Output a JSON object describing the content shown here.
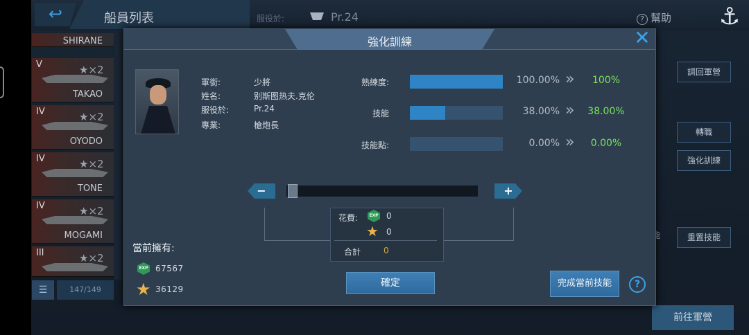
{
  "header": {
    "title": "船員列表",
    "service_label": "服役於:",
    "service_ship": "Pr.24",
    "help_label": "幫助"
  },
  "ship_list": [
    {
      "name": "SHIRANE",
      "tier": "",
      "mult": ""
    },
    {
      "name": "TAKAO",
      "tier": "V",
      "mult": "★×2"
    },
    {
      "name": "OYODO",
      "tier": "IV",
      "mult": "★×2"
    },
    {
      "name": "TONE",
      "tier": "IV",
      "mult": "★×2"
    },
    {
      "name": "MOGAMI",
      "tier": "IV",
      "mult": "★×2"
    },
    {
      "name": "",
      "tier": "III",
      "mult": "★×2"
    }
  ],
  "list_footer": {
    "count": "147/149"
  },
  "right_buttons": {
    "recall": "調回軍營",
    "transfer": "轉職",
    "train": "強化訓練",
    "skill_partial": "能",
    "reset_skill": "重置技能",
    "goto_barracks": "前往軍營"
  },
  "modal": {
    "title": "強化訓練",
    "info": {
      "rank_label": "軍銜:",
      "rank": "少將",
      "name_label": "姓名:",
      "name": "别斯图热夫.克伦",
      "service_label": "服役於:",
      "service": "Pr.24",
      "job_label": "專業:",
      "job": "槍炮長"
    },
    "stats": [
      {
        "label": "熟練度:",
        "current": "100.00%",
        "after": "100%",
        "fill": 1.0
      },
      {
        "label": "技能",
        "current": "38.00%",
        "after": "38.00%",
        "fill": 0.38
      },
      {
        "label": "技能點:",
        "current": "0.00%",
        "after": "0.00%",
        "fill": 0.0
      }
    ],
    "slider": {
      "minus": "−",
      "plus": "+",
      "value": 0
    },
    "cost": {
      "label": "花費:",
      "exp_icon": "EXP",
      "exp": "0",
      "stars": "0",
      "total_label": "合計",
      "total": "0"
    },
    "owned": {
      "title": "當前擁有:",
      "exp_icon": "EXP",
      "exp": "67567",
      "stars": "36129"
    },
    "confirm_label": "確定",
    "complete_label": "完成當前技能",
    "help_icon": "?"
  }
}
